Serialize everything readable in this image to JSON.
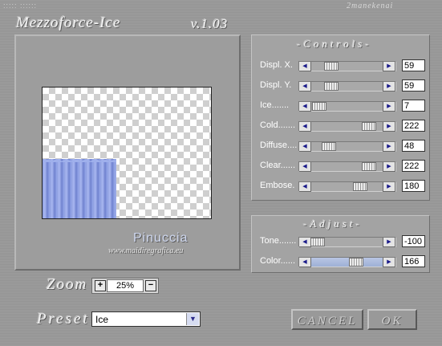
{
  "header": {
    "dots": "::::: ::::::",
    "brand": "2manekenai",
    "title": "Mezzoforce-Ice",
    "version": "v.1.03"
  },
  "preview": {
    "signature": "Pinuccia",
    "website": "www.maidiregrafica.eu"
  },
  "controls": {
    "title": "-Controls-",
    "rows": [
      {
        "label": "Displ. X.",
        "value": "59",
        "level": 0.23
      },
      {
        "label": "Displ. Y.",
        "value": "59",
        "level": 0.23
      },
      {
        "label": "Ice.......",
        "value": "7",
        "level": 0.03
      },
      {
        "label": "Cold.......",
        "value": "222",
        "level": 0.87
      },
      {
        "label": "Diffuse....",
        "value": "48",
        "level": 0.19
      },
      {
        "label": "Clear......",
        "value": "222",
        "level": 0.87
      },
      {
        "label": "Embose.",
        "value": "180",
        "level": 0.71
      }
    ]
  },
  "adjust": {
    "title": "-Adjust-",
    "rows": [
      {
        "label": "Tone.......",
        "value": "-100",
        "level": 0.0
      },
      {
        "label": "Color......",
        "value": "166",
        "level": 0.65
      }
    ]
  },
  "zoom": {
    "label": "Zoom",
    "value": "25%",
    "plus": "+",
    "minus": "−"
  },
  "preset": {
    "label": "Preset",
    "value": "Ice"
  },
  "buttons": {
    "cancel": "CANCEL",
    "ok": "OK"
  },
  "colors": {
    "background": "#9a9a9a",
    "ice_blue": "#8e9fe0",
    "arrow_blue": "#1a1a8a"
  }
}
